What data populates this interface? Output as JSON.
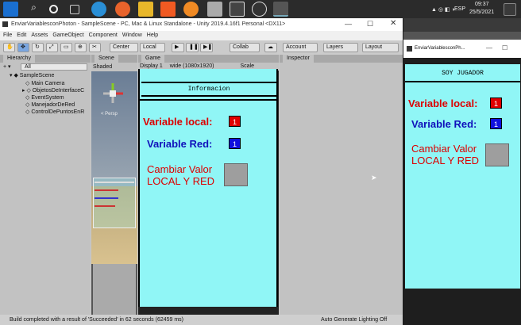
{
  "taskbar": {
    "time": "09:37",
    "date": "25/5/2021",
    "lang": "ESP"
  },
  "unity": {
    "title": "EnviarVariablesconPhoton - SampleScene - PC, Mac & Linux Standalone - Unity 2019.4.16f1 Personal <DX11>",
    "menu": [
      "File",
      "Edit",
      "Assets",
      "GameObject",
      "Component",
      "Window",
      "Help"
    ],
    "toolbar": {
      "pivot": "Center",
      "space": "Local",
      "collab": "Collab",
      "account": "Account",
      "layers": "Layers",
      "layout": "Layout"
    },
    "hierarchy": {
      "tab": "Hierarchy",
      "search": "All",
      "scene": "SampleScene",
      "items": [
        "Main Camera",
        "ObjetosDeInterfaceC",
        "EventSystem",
        "ManejadorDeRed",
        "ControlDePuntosEnR"
      ]
    },
    "scene": {
      "tab": "Scene",
      "shading": "Shaded",
      "persp": "< Persp"
    },
    "game": {
      "tab": "Game",
      "display": "Display 1",
      "aspect": "wide (1080x1920)",
      "scale": "Scale",
      "info": "Informacion",
      "var_local_label": "Variable local:",
      "var_local_value": "1",
      "var_red_label": "Variable Red:",
      "var_red_value": "1",
      "change_line1": "Cambiar Valor",
      "change_line2": "LOCAL Y RED"
    },
    "inspector": {
      "tab": "Inspector"
    },
    "status": {
      "message": "Build completed with a result of 'Succeeded' in 62 seconds (62459 ms)",
      "lighting": "Auto Generate Lighting Off"
    }
  },
  "app": {
    "title": "EnviarVariablesconPh...",
    "header": "SOY JUGADOR",
    "var_local_label": "Variable local:",
    "var_local_value": "1",
    "var_red_label": "Variable Red:",
    "var_red_value": "1",
    "change_line1": "Cambiar Valor",
    "change_line2": "LOCAL Y RED"
  },
  "colors": {
    "canvas": "#90f6f6",
    "local": "#dd0000",
    "red": "#1010bb"
  }
}
